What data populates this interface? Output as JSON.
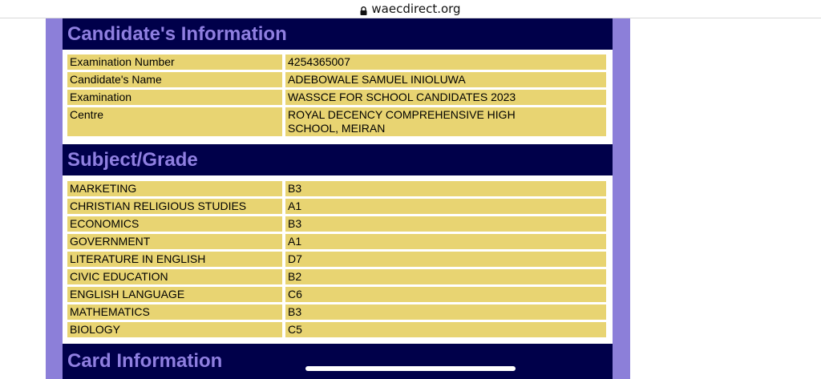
{
  "browser": {
    "url": "waecdirect.org"
  },
  "sections": {
    "candidate_title": "Candidate's Information",
    "subject_title": "Subject/Grade",
    "card_title": "Card Information"
  },
  "candidate": [
    {
      "label": "Examination Number",
      "value": "4254365007"
    },
    {
      "label": "Candidate's Name",
      "value": "ADEBOWALE SAMUEL INIOLUWA"
    },
    {
      "label": "Examination",
      "value": "WASSCE FOR SCHOOL CANDIDATES 2023"
    },
    {
      "label": "Centre",
      "value": "ROYAL DECENCY COMPREHENSIVE HIGH SCHOOL, MEIRAN"
    }
  ],
  "subjects": [
    {
      "subject": "MARKETING",
      "grade": "B3"
    },
    {
      "subject": "CHRISTIAN RELIGIOUS STUDIES",
      "grade": "A1"
    },
    {
      "subject": "ECONOMICS",
      "grade": "B3"
    },
    {
      "subject": "GOVERNMENT",
      "grade": "A1"
    },
    {
      "subject": "LITERATURE IN ENGLISH",
      "grade": "D7"
    },
    {
      "subject": "CIVIC EDUCATION",
      "grade": "B2"
    },
    {
      "subject": "ENGLISH LANGUAGE",
      "grade": "C6"
    },
    {
      "subject": "MATHEMATICS",
      "grade": "B3"
    },
    {
      "subject": "BIOLOGY",
      "grade": "C5"
    }
  ],
  "colors": {
    "header_bg": "#00004a",
    "header_text": "#8f7fe0",
    "frame": "#8c7fd9",
    "cell_bg": "#e8d472"
  },
  "icons": {
    "lock": "lock-icon"
  }
}
